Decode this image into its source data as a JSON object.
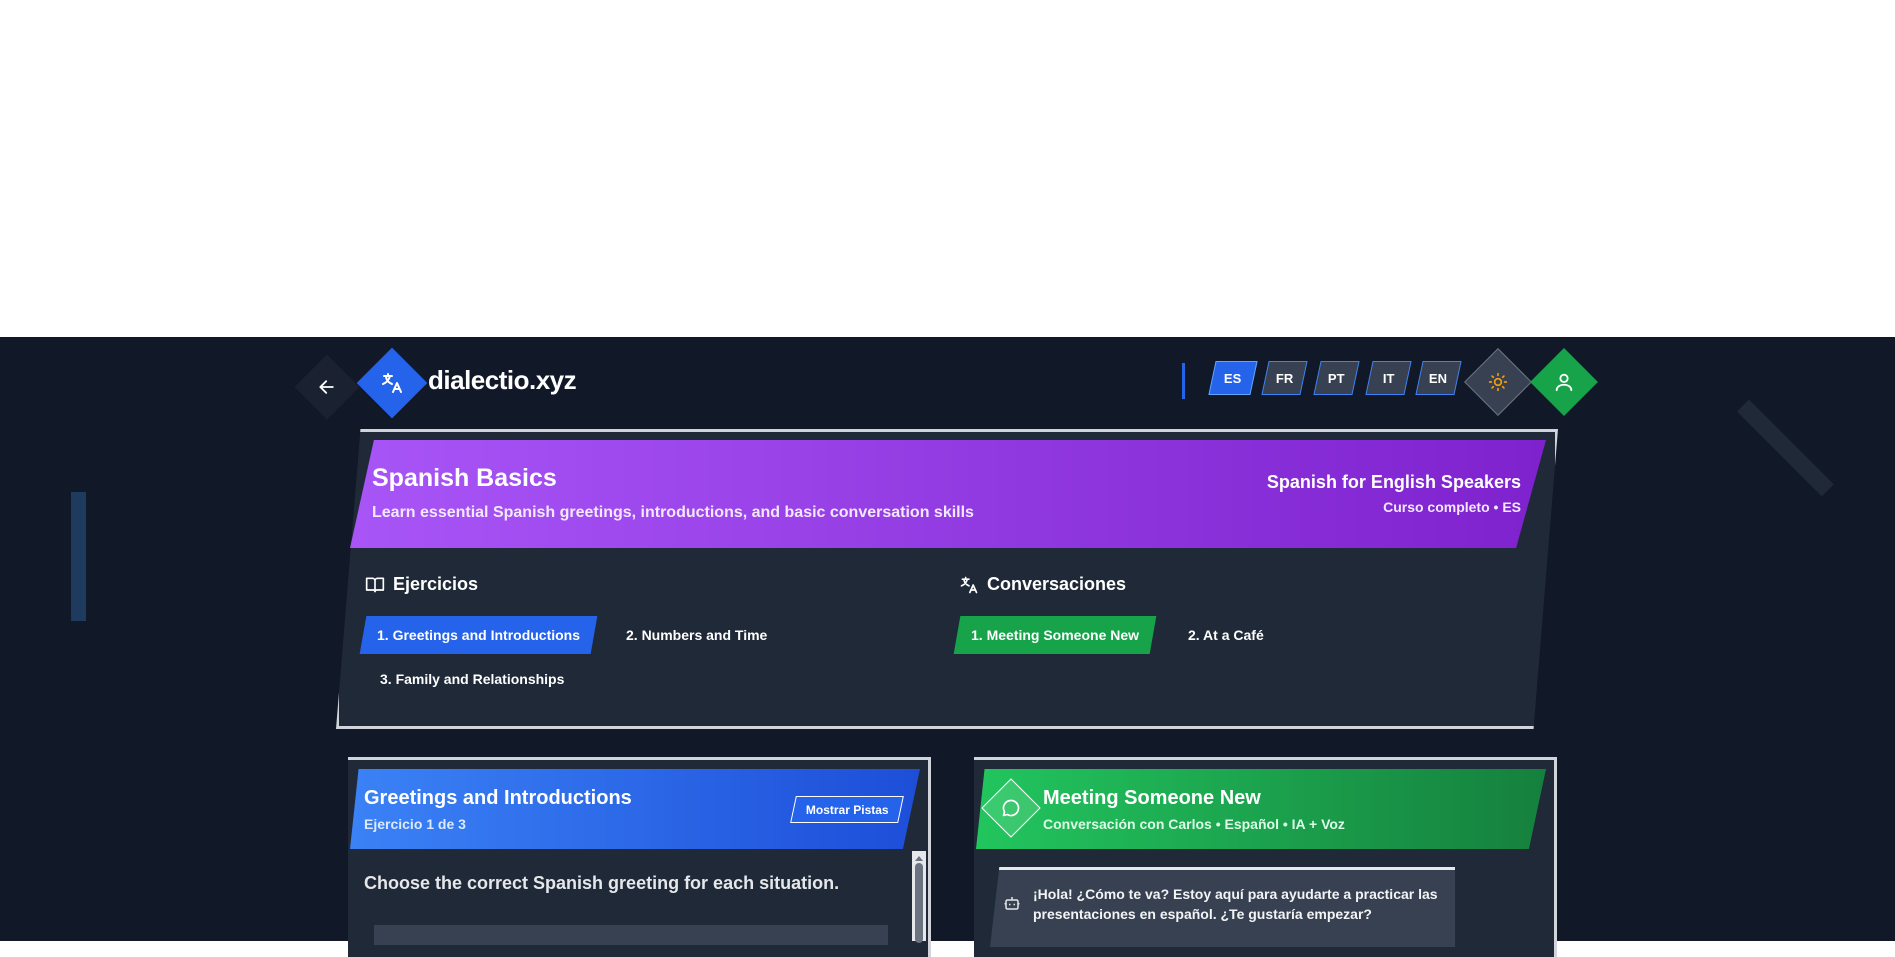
{
  "header": {
    "brand": "dialectio.xyz",
    "languages": [
      {
        "code": "ES",
        "active": true
      },
      {
        "code": "FR",
        "active": false
      },
      {
        "code": "PT",
        "active": false
      },
      {
        "code": "IT",
        "active": false
      },
      {
        "code": "EN",
        "active": false
      }
    ],
    "icons": {
      "back": "arrow-left-icon",
      "logo": "translate-icon",
      "theme": "sun-icon",
      "user": "user-icon"
    }
  },
  "course": {
    "title": "Spanish Basics",
    "subtitle": "Learn essential Spanish greetings, introductions, and basic conversation skills",
    "track": "Spanish for English Speakers",
    "meta": "Curso completo • ES",
    "exercises_heading": "Ejercicios",
    "exercises": [
      "1. Greetings and Introductions",
      "2. Numbers and Time",
      "3. Family and Relationships"
    ],
    "conversations_heading": "Conversaciones",
    "conversations": [
      "1. Meeting Someone New",
      "2. At a Café"
    ]
  },
  "exercise_panel": {
    "title": "Greetings and Introductions",
    "subtitle": "Ejercicio 1 de 3",
    "hint_button": "Mostrar Pistas",
    "instruction": "Choose the correct Spanish greeting for each situation."
  },
  "conversation_panel": {
    "title": "Meeting Someone New",
    "subtitle": "Conversación con Carlos • Español • IA + Voz",
    "message": "¡Hola! ¿Cómo te va? Estoy aquí para ayudarte a practicar las presentaciones en español. ¿Te gustaría empezar?"
  },
  "colors": {
    "background": "#111827",
    "panel": "#1f2937",
    "accent_blue": "#2563eb",
    "accent_purple": "#a855f7",
    "accent_green": "#16a34a"
  }
}
